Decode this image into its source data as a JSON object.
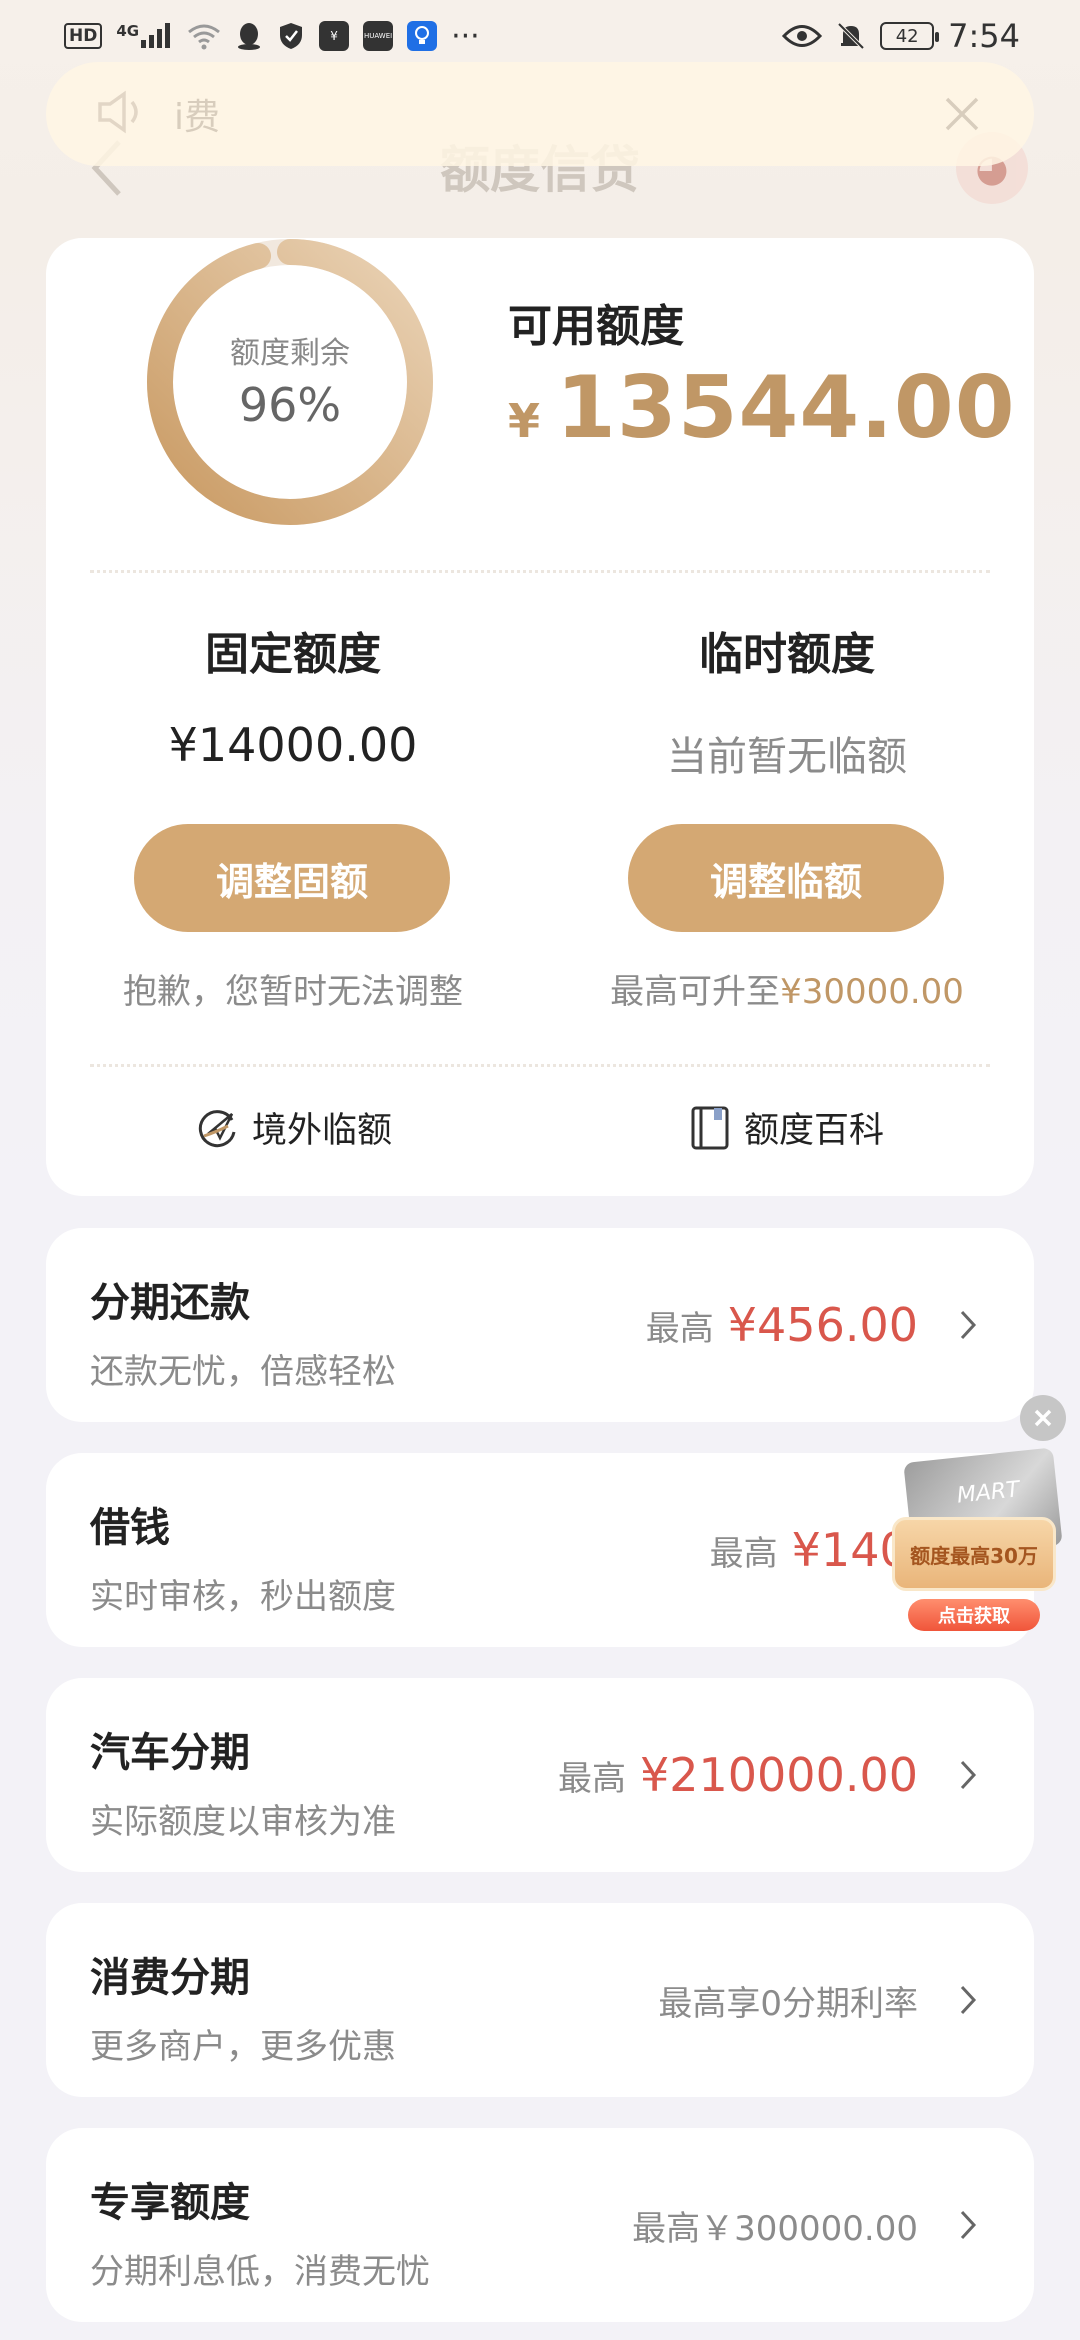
{
  "status_bar": {
    "hd": "HD",
    "network": "4G",
    "app_badge": "HUAWEI",
    "more": "···",
    "battery": "42",
    "time": "7:54"
  },
  "notice": {
    "text": "i费"
  },
  "header": {
    "title": "额度信贷"
  },
  "quota": {
    "ring_label": "额度剩余",
    "ring_value": "96%",
    "ring_fraction": 0.96,
    "available_label": "可用额度",
    "currency": "¥",
    "available_amount": "13544.00"
  },
  "fixed": {
    "title": "固定额度",
    "value": "¥14000.00",
    "button": "调整固额",
    "note": "抱歉，您暂时无法调整"
  },
  "temp": {
    "title": "临时额度",
    "value": "当前暂无临额",
    "button": "调整临额",
    "note_prefix": "最高可升至",
    "note_amount": "¥30000.00"
  },
  "links": {
    "overseas": "境外临额",
    "wiki": "额度百科"
  },
  "products": [
    {
      "title": "分期还款",
      "subtitle": "还款无忧，倍感轻松",
      "prefix": "最高",
      "amount": "¥456.00"
    },
    {
      "title": "借钱",
      "subtitle": "实时审核，秒出额度",
      "prefix": "最高",
      "amount": "¥1400"
    },
    {
      "title": "汽车分期",
      "subtitle": "实际额度以审核为准",
      "prefix": "最高",
      "amount": "¥210000.00"
    },
    {
      "title": "消费分期",
      "subtitle": "更多商户，更多优惠",
      "plain": "最高享0分期利率"
    },
    {
      "title": "专享额度",
      "subtitle": "分期利息低，消费无忧",
      "plain": "最高￥300000.00"
    }
  ],
  "ad": {
    "card_text": "MART",
    "headline": "额度最高30万",
    "cta": "点击获取"
  },
  "colors": {
    "gold": "#c09766",
    "button_gold": "#d4a873",
    "red_amount": "#d9574c",
    "gray_text": "#8b8b8b"
  }
}
